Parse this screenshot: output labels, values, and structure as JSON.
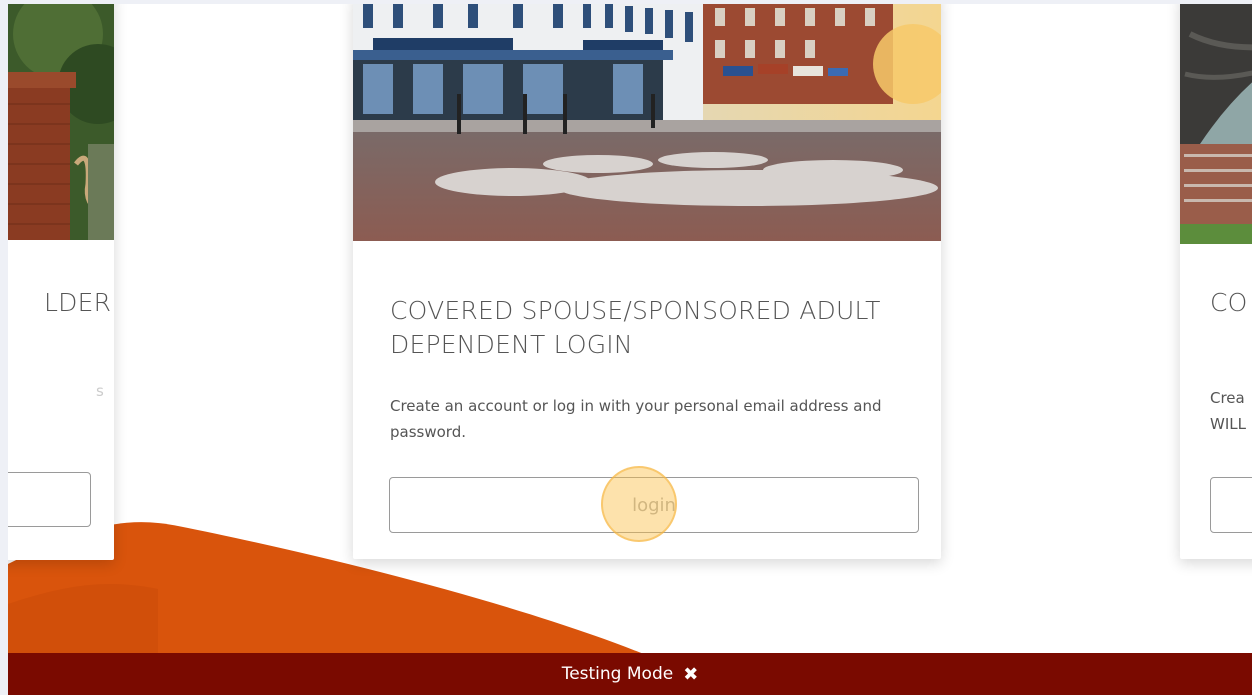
{
  "cards": {
    "left": {
      "title_fragment": "LDER",
      "text_fragment": "s"
    },
    "center": {
      "title": "COVERED SPOUSE/SPONSORED ADULT DEPENDENT LOGIN",
      "text": "Create an account or log in with your personal email address and password.",
      "button": "login"
    },
    "right": {
      "title_fragment": "CO",
      "text_line1": "Crea",
      "text_line2": "WILL"
    }
  },
  "images": {
    "left": "campus-brick-gate-photo",
    "center": "toomers-drugs-street-corner-photo",
    "right": "stadium-eagle-photo"
  },
  "testing_bar": {
    "label": "Testing Mode",
    "close": "✖"
  },
  "colors": {
    "accent_orange": "#d9540c",
    "testing_bar": "#7a0a00"
  }
}
